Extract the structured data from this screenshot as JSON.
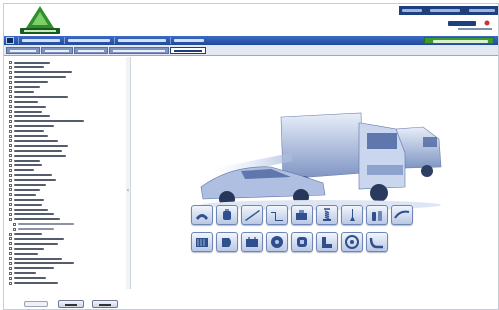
{
  "header": {
    "logo_text": "",
    "brand_text": "",
    "top_links": [
      "",
      "",
      ""
    ]
  },
  "menu": {
    "items": [
      "",
      "",
      "",
      ""
    ],
    "action_button": ""
  },
  "tabs": [
    "",
    "",
    "",
    "",
    ""
  ],
  "sidebar": {
    "items": [
      {
        "label": ""
      },
      {
        "label": ""
      },
      {
        "label": ""
      },
      {
        "label": ""
      },
      {
        "label": ""
      },
      {
        "label": ""
      },
      {
        "label": ""
      },
      {
        "label": ""
      },
      {
        "label": ""
      },
      {
        "label": ""
      },
      {
        "label": ""
      },
      {
        "label": ""
      },
      {
        "label": ""
      },
      {
        "label": ""
      },
      {
        "label": ""
      },
      {
        "label": ""
      },
      {
        "label": ""
      },
      {
        "label": ""
      },
      {
        "label": ""
      },
      {
        "label": ""
      },
      {
        "label": ""
      },
      {
        "label": ""
      },
      {
        "label": ""
      },
      {
        "label": ""
      },
      {
        "label": ""
      },
      {
        "label": ""
      },
      {
        "label": ""
      },
      {
        "label": ""
      },
      {
        "label": ""
      },
      {
        "label": ""
      },
      {
        "label": ""
      },
      {
        "label": ""
      },
      {
        "label": ""
      },
      {
        "label": ""
      },
      {
        "label": ""
      },
      {
        "label": ""
      },
      {
        "label": ""
      },
      {
        "label": ""
      },
      {
        "label": ""
      },
      {
        "label": ""
      },
      {
        "label": ""
      },
      {
        "label": ""
      },
      {
        "label": ""
      },
      {
        "label": ""
      },
      {
        "label": ""
      },
      {
        "label": ""
      }
    ]
  },
  "footer": {
    "search_value": "",
    "buttons": [
      "",
      ""
    ]
  },
  "categories": {
    "row1": [
      "brake-pad-icon",
      "oil-filter-icon",
      "wiper-blade-icon",
      "exhaust-icon",
      "engine-icon",
      "suspension-icon",
      "spark-plug-icon",
      "bottle-icon",
      "belt-icon"
    ],
    "row2": [
      "radiator-icon",
      "lamp-icon",
      "battery-icon",
      "disc-icon",
      "fuel-filter-icon",
      "seat-icon",
      "bearing-icon",
      "hose-icon"
    ]
  },
  "colors": {
    "menu_blue": "#1f4a9c",
    "top_link_blue": "#1d3f7d",
    "green_action": "#3f9a2e",
    "logo_green": "#2f8f2b",
    "vehicle_tint": "#6f86b8"
  }
}
